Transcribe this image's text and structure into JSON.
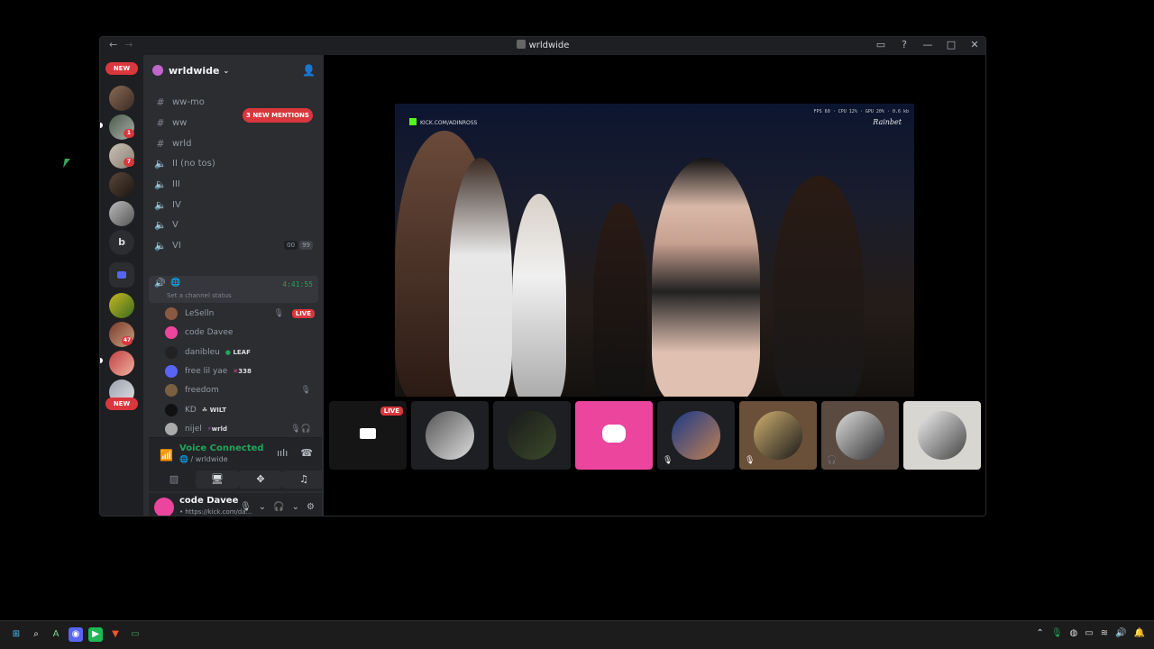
{
  "window": {
    "title": "wrldwide",
    "nav_back": "←",
    "nav_forward": "→",
    "controls": {
      "inbox": "▭",
      "help": "?",
      "minimize": "—",
      "maximize": "□",
      "close": "✕"
    }
  },
  "guilds": {
    "new_top": "NEW",
    "new_bottom": "NEW",
    "letter_server": "b",
    "badges": [
      "1",
      "7",
      "47"
    ]
  },
  "server": {
    "name": "wrldwide",
    "mentions_pill": "3 NEW MENTIONS",
    "channels": [
      {
        "icon": "#",
        "name": "ww-mo"
      },
      {
        "icon": "#",
        "name": "ww"
      },
      {
        "icon": "#",
        "name": "wrld"
      },
      {
        "icon": "🔈",
        "name": "II (no tos)"
      },
      {
        "icon": "🔈",
        "name": "III"
      },
      {
        "icon": "🔈",
        "name": "IV"
      },
      {
        "icon": "🔈",
        "name": "V"
      },
      {
        "icon": "🔈",
        "name": "VI"
      }
    ],
    "vi_counts": [
      "00",
      "99"
    ],
    "active_voice": {
      "icon": "🌐",
      "timer": "4:41:55",
      "status_placeholder": "Set a channel status"
    },
    "voice_users": [
      {
        "name": "LeSelln",
        "tag": "",
        "live": "LIVE",
        "muted": true
      },
      {
        "name": "code Davee",
        "tag": "",
        "live": "",
        "muted": false
      },
      {
        "name": "danibleu",
        "tag": "LEAF",
        "live": "",
        "muted": false
      },
      {
        "name": "free lil yae",
        "tag": "338",
        "live": "",
        "muted": false
      },
      {
        "name": "freedom",
        "tag": "",
        "live": "",
        "muted": true
      },
      {
        "name": "KD",
        "tag": "WILT",
        "live": "",
        "muted": false
      },
      {
        "name": "nijel",
        "tag": "wrld",
        "live": "",
        "muted": true
      }
    ]
  },
  "voice_panel": {
    "connected": "Voice Connected",
    "channel": "/ wrldwide"
  },
  "user_panel": {
    "name": "code Davee",
    "status": "• https://kick.com/da..."
  },
  "stage": {
    "stream_source": "KICK.COM/ADINROSS",
    "stream_stats": "FPS 60 · CPU 12% · GPU 20% · 0.6 kb",
    "brand": "Rainbet",
    "thumb_live": "LIVE"
  },
  "colors": {
    "accent_green": "#23a55a",
    "live_red": "#da373c",
    "discord_pink": "#eb459e"
  }
}
